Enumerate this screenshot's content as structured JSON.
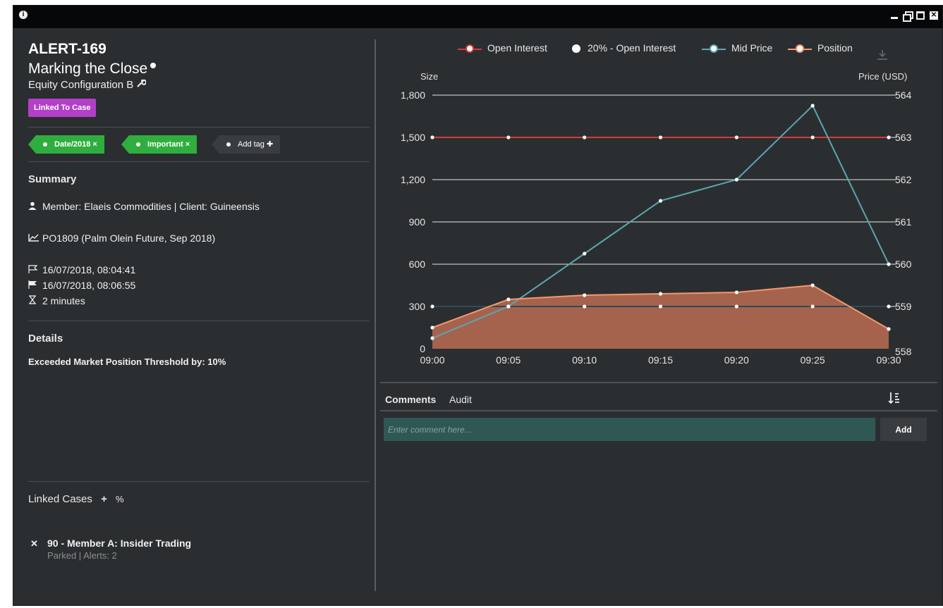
{
  "window": {
    "close_glyph": "✕"
  },
  "alert": {
    "id": "ALERT-169",
    "title": "Marking the Close",
    "config": "Equity Configuration B",
    "badge": "Linked To Case"
  },
  "tags": [
    {
      "label": "Date/2018 ×"
    },
    {
      "label": "Important ×"
    }
  ],
  "add_tag_label": "Add tag ✚",
  "summary": {
    "heading": "Summary",
    "member": "Member: Elaeis Commodities | Client: Guineensis",
    "instrument": "PO1809 (Palm Olein Future, Sep 2018)",
    "start": "16/07/2018, 08:04:41",
    "end": "16/07/2018, 08:06:55",
    "duration": "2 minutes"
  },
  "details": {
    "heading": "Details",
    "text": "Exceeded Market Position Threshold by: 10%"
  },
  "linked_cases": {
    "heading": "Linked Cases",
    "add_glyph": "+",
    "link_glyph": "%",
    "remove_glyph": "✕",
    "items": [
      {
        "title": "90 - Member A: Insider Trading",
        "sub": "Parked | Alerts: 2"
      }
    ]
  },
  "chart_data": {
    "type": "line",
    "legend_position": "top",
    "left_axis_title": "Size",
    "right_axis_title": "Price (USD)",
    "x": [
      "09:00",
      "09:05",
      "09:10",
      "09:15",
      "09:20",
      "09:25",
      "09:30"
    ],
    "left_ylim": [
      0,
      1800
    ],
    "left_ticks": [
      "0",
      "300",
      "600",
      "900",
      "1,200",
      "1,500",
      "1,800"
    ],
    "right_ylim": [
      558,
      564
    ],
    "right_ticks": [
      "558",
      "559",
      "560",
      "561",
      "562",
      "563",
      "564"
    ],
    "grid": true,
    "series": [
      {
        "name": "Open Interest",
        "axis": "left",
        "style": "line",
        "color": "#d83a3a",
        "values": [
          1500,
          1500,
          1500,
          1500,
          1500,
          1500,
          1500
        ]
      },
      {
        "name": "20% - Open Interest",
        "axis": "left",
        "style": "line",
        "color": "#2f4a60",
        "values": [
          300,
          300,
          300,
          300,
          300,
          300,
          300
        ]
      },
      {
        "name": "Mid Price",
        "axis": "right",
        "style": "line",
        "color": "#5aa7b2",
        "values": [
          558.25,
          559.0,
          560.25,
          561.5,
          562.0,
          563.75,
          560.0
        ]
      },
      {
        "name": "Position",
        "axis": "left",
        "style": "area",
        "color": "#f4976c",
        "values": [
          150,
          350,
          380,
          390,
          400,
          450,
          140
        ]
      }
    ]
  },
  "comments": {
    "tabs": [
      "Comments",
      "Audit"
    ],
    "placeholder": "Enter comment here...",
    "add_label": "Add"
  }
}
